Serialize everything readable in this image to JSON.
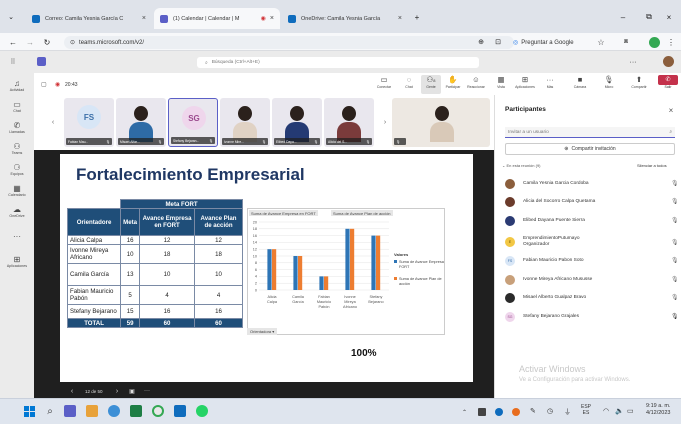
{
  "browser": {
    "tabs": [
      {
        "label": "Correo: Camila Yesnia García C",
        "color": "#0f6cbd"
      },
      {
        "label": "(1) Calendar | Calendar | M",
        "color": "#5b5fc7"
      },
      {
        "label": "OneDrive: Camila Yesnia García",
        "color": "#0f6cbd"
      }
    ],
    "url": "teams.microsoft.com/v2/",
    "ask_google": "Preguntar a Google"
  },
  "teams": {
    "search_placeholder": "Búsqueda (Ctrl+Alt+E)",
    "meeting_time": "20:43",
    "rail": [
      "Actividad",
      "Chat",
      "Llamadas",
      "Teams",
      "Equipos",
      "Calendario",
      "OneDrive",
      "",
      "Aplicaciones"
    ],
    "controls": [
      "Conectar",
      "Chat",
      "Gente",
      "Participar",
      "Reaccionar",
      "Vista",
      "Aplicaciones",
      "Más",
      "Cámara",
      "Micro",
      "Compartir",
      "Salir"
    ],
    "people_count": "8"
  },
  "tiles": [
    {
      "initials": "FS",
      "name": "Fabian Mau...",
      "color": "#3a6fa8"
    },
    {
      "initials": "",
      "name": "Misael Alfar...",
      "color": "#2e6ba6"
    },
    {
      "initials": "SG",
      "name": "Stefany Bejaran...",
      "color": "#9b4a8e"
    },
    {
      "initials": "",
      "name": "Ivonne Mire...",
      "color": "#e0d2c4"
    },
    {
      "initials": "",
      "name": "Elibed Daya...",
      "color": "#243a73"
    },
    {
      "initials": "",
      "name": "Alicia del S...",
      "color": "#7a3b3b"
    },
    {
      "initials": "",
      "name": "",
      "color": "#d9c9b8"
    }
  ],
  "slide": {
    "title": "Fortalecimiento Empresarial",
    "table": {
      "group_header": "Meta FORT",
      "headers": [
        "Orientadore",
        "Meta",
        "Avance Empresa en FORT",
        "Avance Plan de acción"
      ],
      "rows": [
        [
          "Alicia Calpa",
          "16",
          "12",
          "12"
        ],
        [
          "Ivonne Mireya Africano",
          "10",
          "18",
          "18"
        ],
        [
          "Camila García",
          "13",
          "10",
          "10"
        ],
        [
          "Fabian Mauricio Pabón",
          "5",
          "4",
          "4"
        ],
        [
          "Stefany Bejarano",
          "15",
          "16",
          "16"
        ]
      ],
      "total": [
        "TOTAL",
        "59",
        "60",
        "60"
      ]
    },
    "percent": "100%",
    "page": "12 de 50"
  },
  "chart_data": {
    "type": "bar",
    "categories": [
      "Alicia Calpa",
      "Camila García",
      "Fabian Mauricio Pabón",
      "Ivonne Mireya Africano",
      "Stefany Bejarano"
    ],
    "series": [
      {
        "name": "Suma de Avance Empresa en FORT",
        "values": [
          12,
          10,
          4,
          18,
          16
        ],
        "color": "#2e75b6"
      },
      {
        "name": "Suma de Avance Plan de acción",
        "values": [
          12,
          10,
          4,
          18,
          16
        ],
        "color": "#ed7d31"
      }
    ],
    "header_labels": [
      "Suma de Avance Empresa en FORT",
      "Suma de Avance Plan de acción"
    ],
    "legend_title": "Valores",
    "filter_label": "Orientadora",
    "ylim": [
      0,
      20
    ],
    "yticks": [
      "0",
      "2",
      "4",
      "6",
      "8",
      "10",
      "12",
      "14",
      "16",
      "18",
      "20"
    ],
    "legend_position": "right"
  },
  "panel": {
    "title": "Participantes",
    "invite_placeholder": "Invitar a un usuario",
    "share_label": "Compartir invitación",
    "section": "En esta reunión (9)",
    "mute_all": "Silenciar a todos",
    "people": [
      {
        "name": "Camila Yesnia Garcia Cordoba",
        "color": "#8b5e3c",
        "initials": ""
      },
      {
        "name": "Alicia del Socorro Calpa Quetama",
        "color": "#6b3b2b",
        "initials": ""
      },
      {
        "name": "Elibed Dayana Puente Sierra",
        "color": "#2b3b73",
        "initials": ""
      },
      {
        "name": "EmprendimientoPutumayo Organizador",
        "color": "#f2c744",
        "initials": "E"
      },
      {
        "name": "Fabian Mauricio Pabon Soto",
        "color": "#d8e6f6",
        "initials": "FS"
      },
      {
        "name": "Ivonne Mireya Africano Mususse",
        "color": "#c8a07a",
        "initials": ""
      },
      {
        "name": "Misael Alberto Gualpaz Bravo",
        "color": "#2b2b2b",
        "initials": ""
      },
      {
        "name": "Stefany Bejarano Grajales",
        "color": "#efd6ec",
        "initials": "SG"
      }
    ],
    "activate_title": "Activar Windows",
    "activate_sub": "Ve a Configuración para activar Windows."
  },
  "taskbar": {
    "lang": "ESP",
    "lang2": "ES",
    "time": "9:19 a. m.",
    "date": "4/12/2023"
  }
}
